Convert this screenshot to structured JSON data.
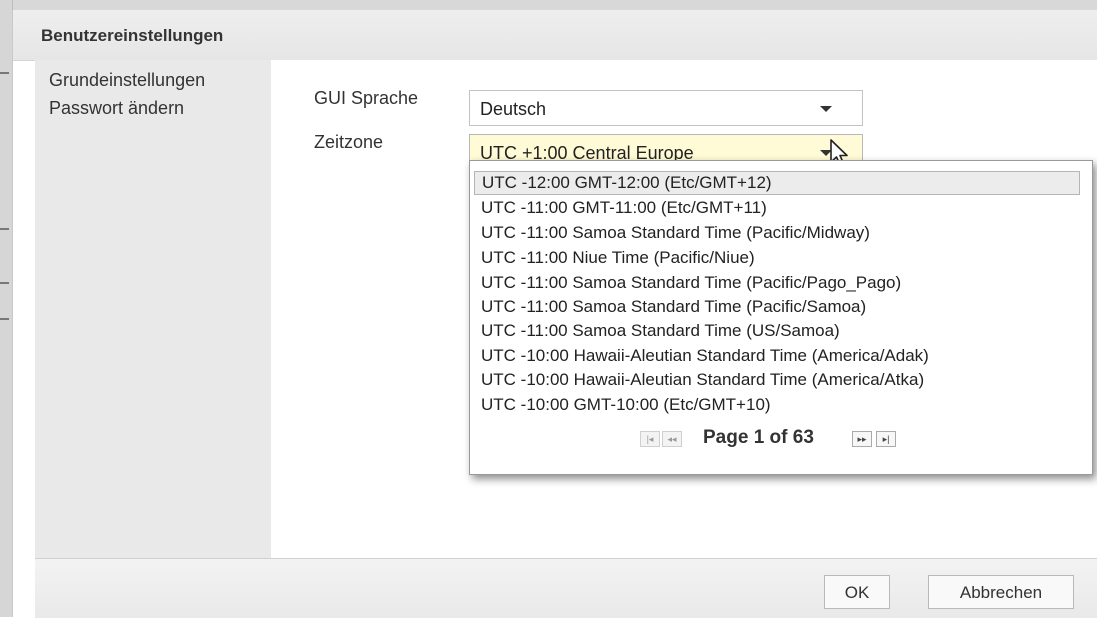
{
  "dialog": {
    "title": "Benutzereinstellungen"
  },
  "sidebar": {
    "items": [
      {
        "label": "Grundeinstellungen"
      },
      {
        "label": "Passwort ändern"
      }
    ]
  },
  "form": {
    "gui_language": {
      "label": "GUI Sprache",
      "value": "Deutsch"
    },
    "timezone": {
      "label": "Zeitzone",
      "value_part1": "UTC",
      "value_part2": " +1:00 Central ",
      "value_part3": "Europe"
    }
  },
  "dropdown": {
    "options": [
      "UTC -12:00 GMT-12:00 (Etc/GMT+12)",
      "UTC -11:00 GMT-11:00 (Etc/GMT+11)",
      "UTC -11:00 Samoa Standard Time (Pacific/Midway)",
      "UTC -11:00 Niue Time (Pacific/Niue)",
      "UTC -11:00 Samoa Standard Time (Pacific/Pago_Pago)",
      "UTC -11:00 Samoa Standard Time (Pacific/Samoa)",
      "UTC -11:00 Samoa Standard Time (US/Samoa)",
      "UTC -10:00 Hawaii-Aleutian Standard Time (America/Adak)",
      "UTC -10:00 Hawaii-Aleutian Standard Time (America/Atka)",
      "UTC -10:00 GMT-10:00 (Etc/GMT+10)"
    ],
    "selected_index": 0,
    "pager": {
      "text": "Page 1 of 63",
      "first_icon": "first-page-icon",
      "prev_icon": "prev-page-icon",
      "next_icon": "next-page-icon",
      "last_icon": "last-page-icon"
    }
  },
  "footer": {
    "ok_label": "OK",
    "cancel_label": "Abbrechen"
  },
  "colors": {
    "focused_field_bg": "#fffbd6",
    "selected_option_bg": "#ececec"
  }
}
